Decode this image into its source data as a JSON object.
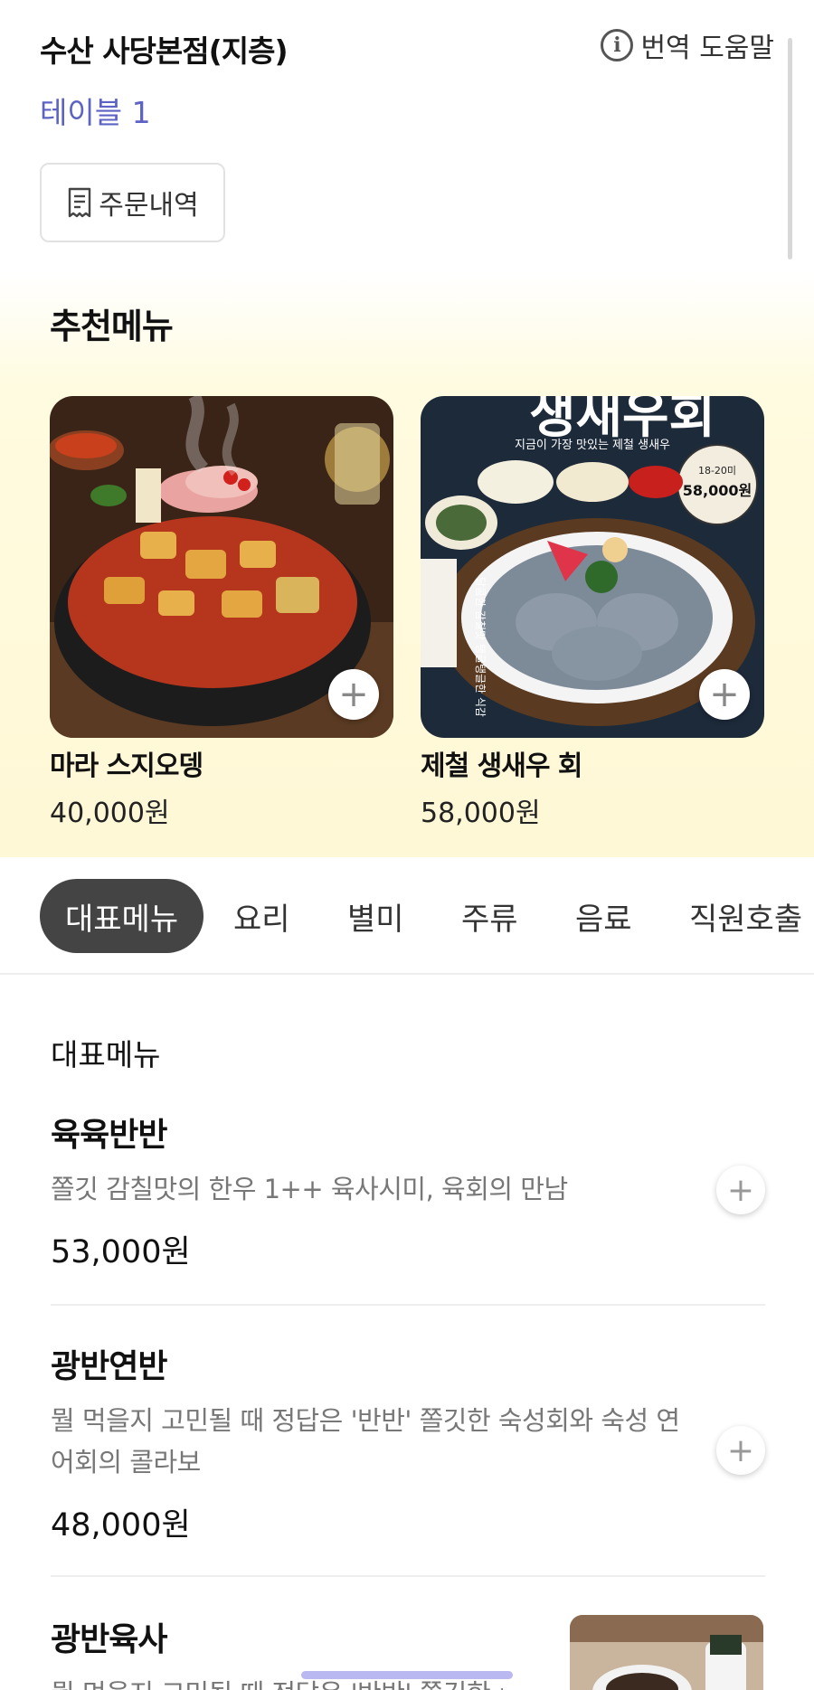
{
  "header": {
    "store_name": "수산 사당본점(지층)",
    "help_label": "번역 도움말",
    "help_icon": "info-icon",
    "table_label": "테이블 1",
    "order_history_label": "주문내역",
    "order_history_icon": "receipt-icon"
  },
  "recommended": {
    "title": "추천메뉴",
    "items": [
      {
        "name": "마라 스지오뎅",
        "price": "40,000원",
        "image": "mala-hotpot-photo"
      },
      {
        "name": "제철 생새우 회",
        "price": "58,000원",
        "image": "raw-shrimp-photo",
        "image_text": {
          "headline": "생새우회",
          "subline": "지금이 가장 맛있는 제철 생새우",
          "badge_count": "18-20미",
          "badge_price": "58,000원",
          "side_text": "달콤한 감칠맛 탱글탱글한 식감"
        }
      }
    ]
  },
  "tabs": [
    {
      "label": "대표메뉴",
      "active": true
    },
    {
      "label": "요리",
      "active": false
    },
    {
      "label": "별미",
      "active": false
    },
    {
      "label": "주류",
      "active": false
    },
    {
      "label": "음료",
      "active": false
    },
    {
      "label": "직원호출",
      "active": false
    }
  ],
  "menu": {
    "section_label": "대표메뉴",
    "items": [
      {
        "name": "육육반반",
        "desc": "쫄깃 감칠맛의 한우 1++ 육사시미, 육회의 만남",
        "price": "53,000원"
      },
      {
        "name": "광반연반",
        "desc": "뭘 먹을지 고민될 때 정답은 '반반' 쫄깃한 숙성회와 숙성 연어회의 콜라보",
        "price": "48,000원"
      },
      {
        "name": "광반육사",
        "desc": "뭘 먹을지 고민될 때 정답은 '반반' 쫄깃한 숙",
        "price": ""
      }
    ]
  },
  "colors": {
    "accent": "#5c63c4",
    "active_tab": "#444444",
    "reco_bg": "#fff8d6",
    "home_indicator": "#b9b8f0"
  }
}
